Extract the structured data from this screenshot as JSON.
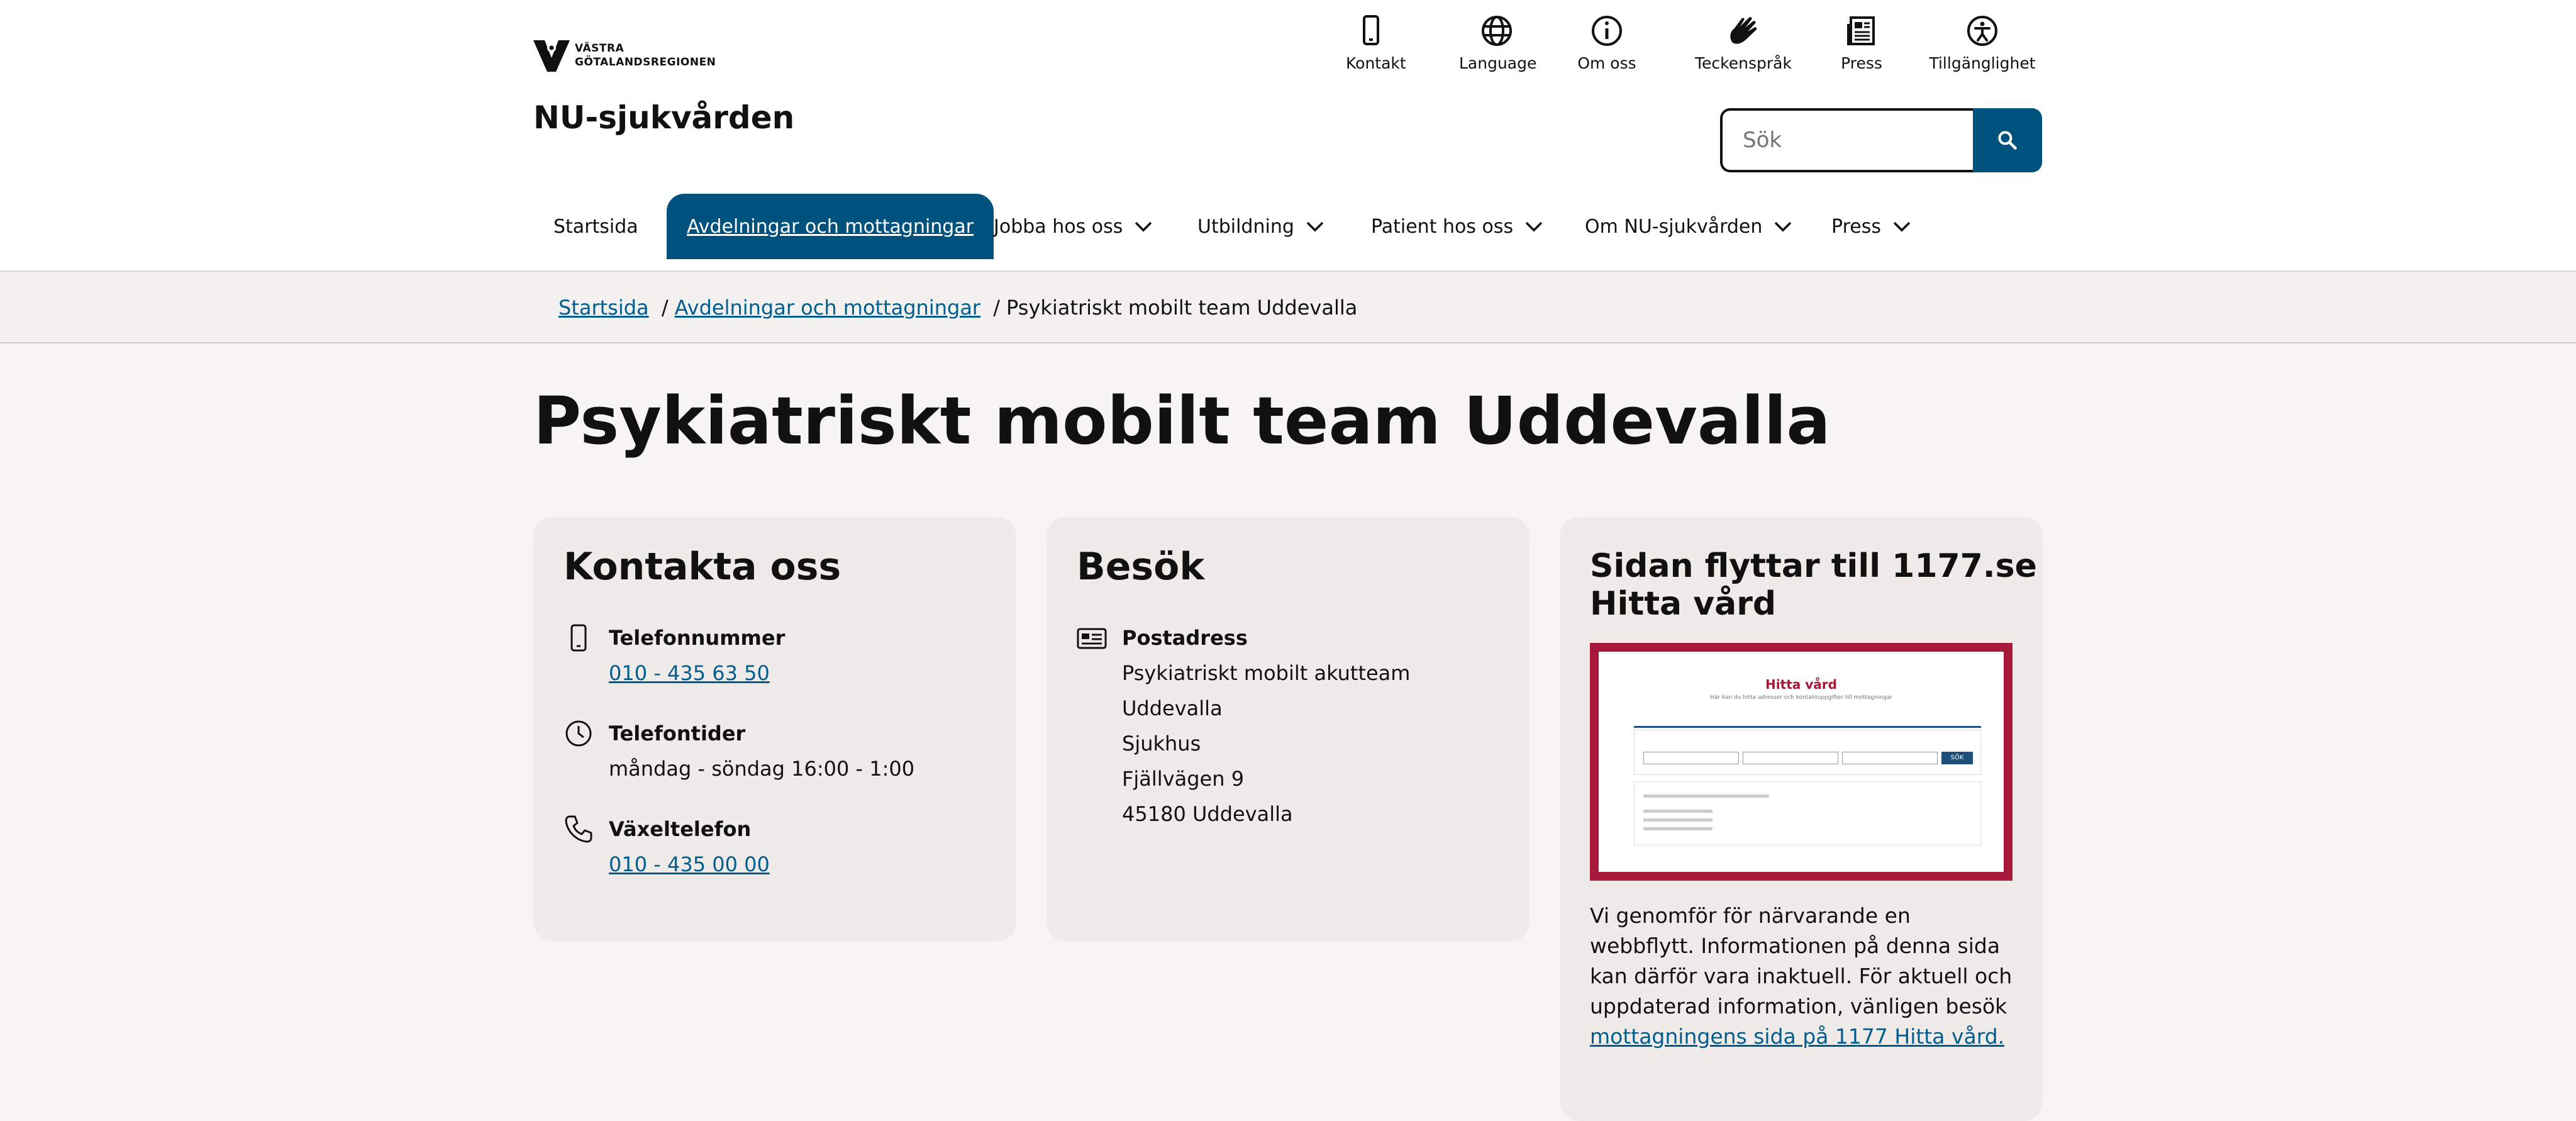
{
  "brand": {
    "logo_line1": "VÄSTRA",
    "logo_line2": "GÖTALANDSREGIONEN",
    "site_title": "NU-sjukvården"
  },
  "utility_nav": [
    {
      "label": "Kontakt",
      "icon": "mobile-phone-icon"
    },
    {
      "label": "Language",
      "icon": "globe-icon"
    },
    {
      "label": "Om oss",
      "icon": "info-icon"
    },
    {
      "label": "Teckenspråk",
      "icon": "sign-language-icon"
    },
    {
      "label": "Press",
      "icon": "newspaper-icon"
    },
    {
      "label": "Tillgänglighet",
      "icon": "accessibility-icon"
    }
  ],
  "search": {
    "placeholder": "Sök",
    "button_icon": "search-icon"
  },
  "main_nav": [
    {
      "label": "Startsida",
      "has_dropdown": false,
      "active": false
    },
    {
      "label": "Avdelningar och mottagningar",
      "has_dropdown": false,
      "active": true
    },
    {
      "label": "Jobba hos oss",
      "has_dropdown": true,
      "active": false
    },
    {
      "label": "Utbildning",
      "has_dropdown": true,
      "active": false
    },
    {
      "label": "Patient hos oss",
      "has_dropdown": true,
      "active": false
    },
    {
      "label": "Om NU-sjukvården",
      "has_dropdown": true,
      "active": false
    },
    {
      "label": "Press",
      "has_dropdown": true,
      "active": false
    }
  ],
  "breadcrumb": {
    "items": [
      "Startsida",
      "Avdelningar och mottagningar"
    ],
    "current": "Psykiatriskt mobilt team Uddevalla",
    "separator": "/"
  },
  "page_title": "Psykiatriskt mobilt team Uddevalla",
  "contact_card": {
    "heading": "Kontakta oss",
    "phone_label": "Telefonnummer",
    "phone_value": "010 - 435 63 50",
    "hours_label": "Telefontider",
    "hours_value": "måndag - söndag 16:00 - 1:00",
    "switchboard_label": "Växeltelefon",
    "switchboard_value": "010 - 435 00 00"
  },
  "visit_card": {
    "heading": "Besök",
    "postal_label": "Postadress",
    "postal_lines": [
      "Psykiatriskt mobilt akutteam Uddevalla",
      "Sjukhus",
      "Fjällvägen 9",
      "45180 Uddevalla"
    ]
  },
  "move_card": {
    "heading_line1": "Sidan flyttar till 1177.se",
    "heading_line2": "Hitta vård",
    "thumb": {
      "title": "Hitta vård",
      "subtitle": "Här kan du hitta adresser och kontaktuppgifter till mottagningar",
      "button": "SÖK"
    },
    "notice_text": "Vi genomför för närvarande en webbflytt. Informationen på denna sida kan därför vara inaktuell. För aktuell och uppdaterad information, vänligen besök",
    "link_text": "mottagningens sida på 1177 Hitta vård."
  },
  "colors": {
    "primary": "#00527e",
    "link": "#005d8f",
    "card_bg": "#efebe9",
    "thumb_border": "#a6193b"
  }
}
